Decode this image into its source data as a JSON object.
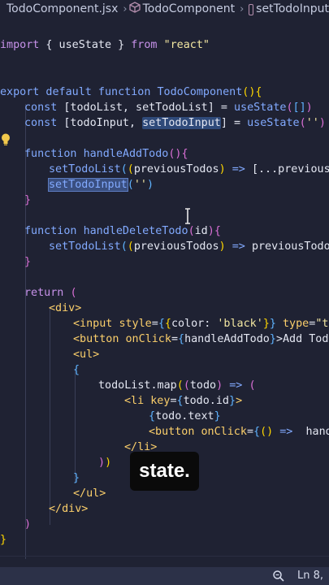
{
  "breadcrumb": {
    "file": "TodoComponent.jsx",
    "component": "TodoComponent",
    "symbol": "setTodoInput"
  },
  "code": {
    "import_kw": "import",
    "import_body": " { useState } ",
    "from_kw": "from",
    "import_src": "\"react\"",
    "export_kw": "export default function ",
    "component_name": "TodoComponent",
    "const_kw": "const",
    "todolist_decl": " [todoList, setTodoList] = ",
    "usestate": "useState",
    "todoinput_decl": " [todoInput, ",
    "set_todo_input": "setTodoInput",
    "todoinput_rest": "] = ",
    "function_kw": "function ",
    "handle_add": "handleAddTodo",
    "set_todo_list": "setTodoList",
    "prev_todos": "previousTodos",
    "arrow": " => ",
    "spread": "[...previousTo",
    "empty_str": "''",
    "handle_delete": "handleDeleteTodo",
    "id_param": "id",
    "prev_todos_dot": "previousTodos.",
    "return_kw": "return ",
    "div_open": "<div>",
    "input_tag": "<input ",
    "style_attr": "style",
    "color_prop": "color: ",
    "black_str": "'black'",
    "type_attr": " type",
    "type_partial": "\"tex",
    "button_tag": "<button ",
    "onclick_attr": "onClick",
    "add_todo_text": ">Add Todo<",
    "ul_open": "<ul>",
    "todolist_map": "todoList.map",
    "todo_param": "todo",
    "li_tag": "<li ",
    "key_attr": "key",
    "todo_id": "todo.id",
    "todo_text": "todo.text",
    "handle_partial": " handle",
    "li_close": "</li>",
    "ul_close": "</ul>",
    "div_close": "</div>"
  },
  "caption": "state.",
  "status": {
    "position": "Ln 8,"
  }
}
